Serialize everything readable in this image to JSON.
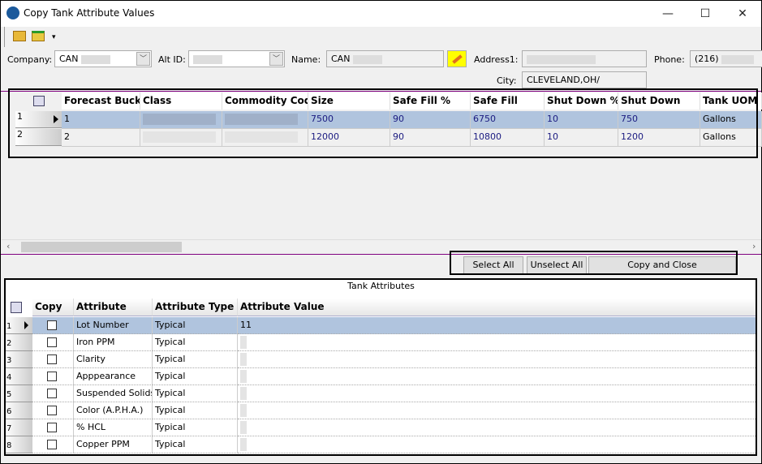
{
  "window": {
    "title": "Copy Tank Attribute Values",
    "minimize": "—",
    "maximize": "☐",
    "close": "✕"
  },
  "toolbar": {
    "open_icon": "folder-open-icon",
    "export_icon": "folder-up-icon",
    "overflow": "▾"
  },
  "form": {
    "company_label": "Company:",
    "company_value": "CAN",
    "altid_label": "Alt ID:",
    "altid_value": "",
    "name_label": "Name:",
    "name_value": "CAN",
    "address_label": "Address1:",
    "address_value": "",
    "phone_label": "Phone:",
    "phone_value": "(216)",
    "city_label": "City:",
    "city_value": "CLEVELAND,OH/"
  },
  "tanks": {
    "columns": [
      "Forecast Bucke",
      "Class",
      "Commodity Code",
      "Size",
      "Safe Fill %",
      "Safe Fill",
      "Shut Down %",
      "Shut Down",
      "Tank UOM"
    ],
    "rows": [
      [
        "1",
        "",
        "",
        "7500",
        "90",
        "6750",
        "10",
        "750",
        "Gallons"
      ],
      [
        "2",
        "",
        "",
        "12000",
        "90",
        "10800",
        "10",
        "1200",
        "Gallons"
      ]
    ],
    "selected_row": 0
  },
  "buttons": {
    "select_all": "Select All",
    "unselect_all": "Unselect All",
    "copy_close": "Copy and Close"
  },
  "attributes": {
    "caption": "Tank Attributes",
    "columns": [
      "Copy",
      "Attribute",
      "Attribute Type",
      "Attribute Value"
    ],
    "rows": [
      {
        "attr": "Lot Number",
        "type": "Typical",
        "value": "11",
        "copy": false
      },
      {
        "attr": "Iron PPM",
        "type": "Typical",
        "value": "",
        "copy": false
      },
      {
        "attr": "Clarity",
        "type": "Typical",
        "value": "",
        "copy": false
      },
      {
        "attr": "Apppearance",
        "type": "Typical",
        "value": "",
        "copy": false
      },
      {
        "attr": "Suspended Solids",
        "type": "Typical",
        "value": "",
        "copy": false
      },
      {
        "attr": "Color (A.P.H.A.)",
        "type": "Typical",
        "value": "",
        "copy": false
      },
      {
        "attr": "% HCL",
        "type": "Typical",
        "value": "",
        "copy": false
      },
      {
        "attr": "Copper PPM",
        "type": "Typical",
        "value": "",
        "copy": false
      }
    ],
    "selected_row": 0
  },
  "colors": {
    "selection": "#b0c4de",
    "splitter": "#800080",
    "edit_button": "#ffff00"
  }
}
